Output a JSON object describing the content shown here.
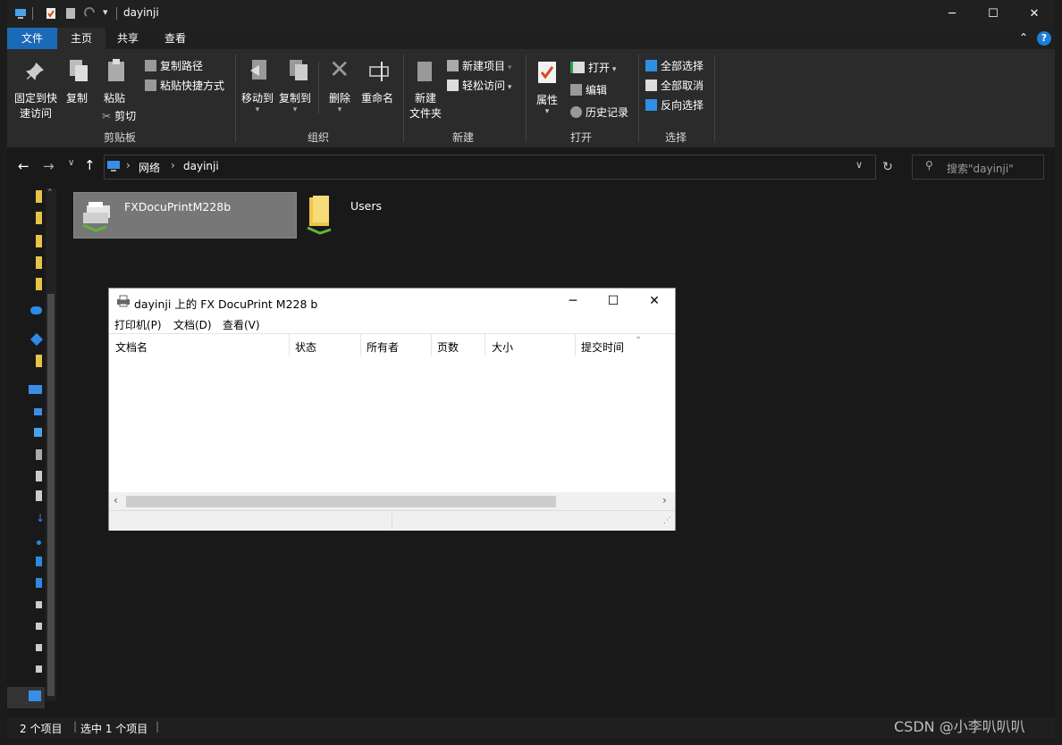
{
  "window": {
    "title": "dayinji",
    "minimize": "─",
    "maximize": "☐",
    "close": "✕"
  },
  "ribbon_tabs": [
    "文件",
    "主页",
    "共享",
    "查看"
  ],
  "ribbon": {
    "clipboard": {
      "pin_label_1": "固定到快",
      "pin_label_2": "速访问",
      "copy": "复制",
      "paste": "粘贴",
      "copy_path": "复制路径",
      "paste_shortcut": "粘贴快捷方式",
      "cut": "剪切",
      "group": "剪贴板"
    },
    "organize": {
      "move_to": "移动到",
      "copy_to": "复制到",
      "delete": "删除",
      "rename": "重命名",
      "group": "组织"
    },
    "new": {
      "new_folder_1": "新建",
      "new_folder_2": "文件夹",
      "new_item": "新建项目",
      "easy_access": "轻松访问",
      "group": "新建"
    },
    "open": {
      "properties": "属性",
      "open": "打开",
      "edit": "编辑",
      "history": "历史记录",
      "group": "打开"
    },
    "select": {
      "select_all": "全部选择",
      "select_none": "全部取消",
      "invert": "反向选择",
      "group": "选择"
    }
  },
  "address": {
    "breadcrumb": [
      "网络",
      "dayinji"
    ],
    "search_placeholder": "搜索\"dayinji\""
  },
  "content": {
    "items": [
      {
        "name": "FXDocuPrintM228b",
        "icon": "network-printer-icon",
        "selected": true
      },
      {
        "name": "Users",
        "icon": "shared-folder-icon",
        "selected": false
      }
    ]
  },
  "statusbar": {
    "count": "2 个项目",
    "selected": "选中 1 个项目"
  },
  "dialog": {
    "title": "dayinji 上的 FX DocuPrint M228 b",
    "menus": [
      "打印机(P)",
      "文档(D)",
      "查看(V)"
    ],
    "columns": [
      "文档名",
      "状态",
      "所有者",
      "页数",
      "大小",
      "提交时间"
    ]
  },
  "watermark": "CSDN @小李叭叭叭",
  "colors": {
    "accent": "#1a6ab8",
    "dark_bg": "#191919",
    "ribbon_bg": "#2b2b2b"
  }
}
